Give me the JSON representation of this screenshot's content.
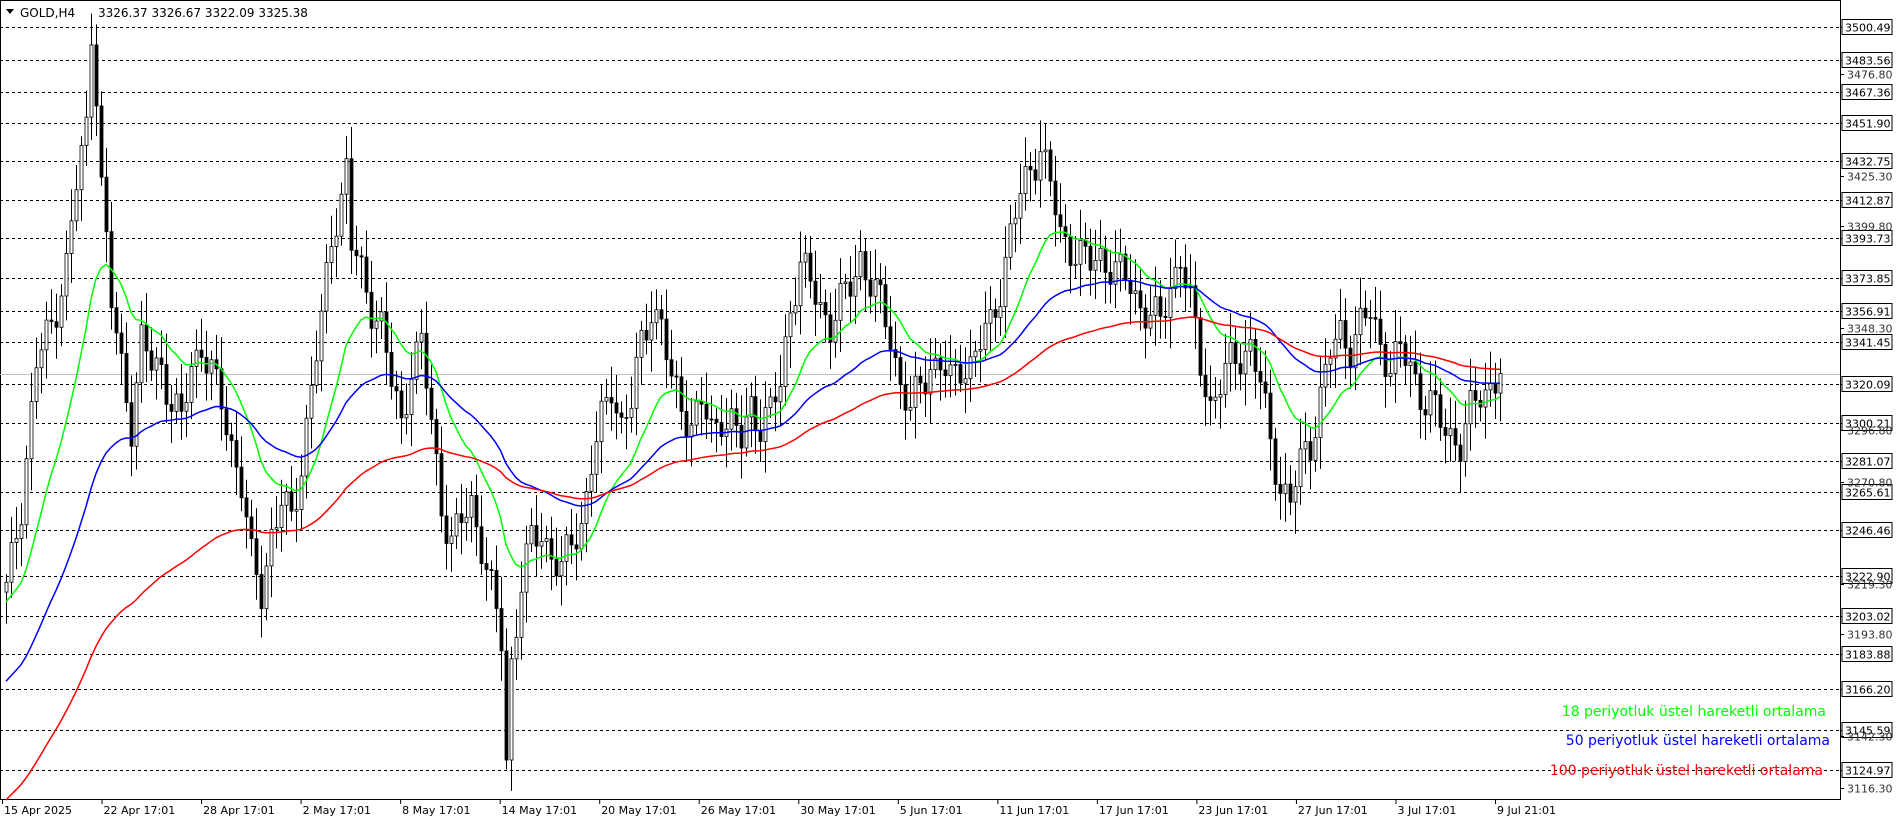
{
  "header": {
    "arrow_icon": "triangle-down-icon",
    "symbol": "GOLD,H4",
    "ohlc": "3326.37 3326.67 3322.09 3325.38"
  },
  "colors": {
    "background": "#ffffff",
    "grid": "#000000",
    "candle": "#000000",
    "ema18": "#00ff00",
    "ema50": "#0000ff",
    "ema100": "#ff0000",
    "bid_line": "#c0c0c0"
  },
  "legend": [
    {
      "text": "18 periyotluk üstel hareketli ortalama",
      "color": "#00ff00"
    },
    {
      "text": "50 periyotluk üstel hareketli ortalama",
      "color": "#0000ff"
    },
    {
      "text": "100 periyotluk üstel hareketli ortalama",
      "color": "#ff0000"
    }
  ],
  "chart_data": {
    "type": "line",
    "title": "GOLD,H4",
    "ylim": [
      3110,
      3514
    ],
    "grid": "horizontal dashed lines at boxed price levels",
    "price_levels": [
      3500.49,
      3483.56,
      3467.36,
      3451.9,
      3432.75,
      3412.87,
      3393.73,
      3373.85,
      3356.91,
      3341.45,
      3320.09,
      3300.21,
      3281.07,
      3265.61,
      3246.46,
      3222.9,
      3203.02,
      3183.88,
      3166.2,
      3145.59,
      3124.97
    ],
    "plain_tick_labels": [
      3476.8,
      3425.3,
      3399.8,
      3348.3,
      3296.8,
      3270.8,
      3219.3,
      3193.8,
      3142.3,
      3116.3
    ],
    "current_price": 3325.38,
    "x_labels": [
      "15 Apr 2025",
      "22 Apr 17:01",
      "28 Apr 17:01",
      "2 May 17:01",
      "8 May 17:01",
      "14 May 17:01",
      "20 May 17:01",
      "26 May 17:01",
      "30 May 17:01",
      "5 Jun 17:01",
      "11 Jun 17:01",
      "17 Jun 17:01",
      "23 Jun 17:01",
      "27 Jun 17:01",
      "3 Jul 17:01",
      "9 Jul 21:01"
    ],
    "close_profile": [
      [
        0,
        3215
      ],
      [
        3,
        3260
      ],
      [
        6,
        3330
      ],
      [
        9,
        3350
      ],
      [
        12,
        3380
      ],
      [
        14,
        3420
      ],
      [
        16,
        3450
      ],
      [
        17,
        3500
      ],
      [
        18,
        3470
      ],
      [
        19,
        3420
      ],
      [
        21,
        3360
      ],
      [
        23,
        3330
      ],
      [
        25,
        3300
      ],
      [
        27,
        3340
      ],
      [
        29,
        3330
      ],
      [
        31,
        3330
      ],
      [
        33,
        3310
      ],
      [
        35,
        3300
      ],
      [
        37,
        3330
      ],
      [
        39,
        3340
      ],
      [
        41,
        3325
      ],
      [
        43,
        3310
      ],
      [
        45,
        3290
      ],
      [
        47,
        3270
      ],
      [
        49,
        3230
      ],
      [
        51,
        3215
      ],
      [
        53,
        3245
      ],
      [
        55,
        3260
      ],
      [
        57,
        3250
      ],
      [
        59,
        3280
      ],
      [
        61,
        3320
      ],
      [
        63,
        3350
      ],
      [
        65,
        3395
      ],
      [
        67,
        3415
      ],
      [
        68,
        3430
      ],
      [
        69,
        3390
      ],
      [
        71,
        3375
      ],
      [
        73,
        3360
      ],
      [
        75,
        3350
      ],
      [
        77,
        3320
      ],
      [
        79,
        3300
      ],
      [
        81,
        3330
      ],
      [
        83,
        3340
      ],
      [
        85,
        3300
      ],
      [
        87,
        3260
      ],
      [
        89,
        3240
      ],
      [
        91,
        3250
      ],
      [
        93,
        3260
      ],
      [
        95,
        3240
      ],
      [
        97,
        3215
      ],
      [
        99,
        3190
      ],
      [
        100,
        3130
      ],
      [
        101,
        3180
      ],
      [
        103,
        3220
      ],
      [
        105,
        3240
      ],
      [
        107,
        3245
      ],
      [
        109,
        3235
      ],
      [
        111,
        3225
      ],
      [
        113,
        3240
      ],
      [
        115,
        3250
      ],
      [
        117,
        3280
      ],
      [
        119,
        3300
      ],
      [
        121,
        3320
      ],
      [
        123,
        3300
      ],
      [
        125,
        3310
      ],
      [
        127,
        3340
      ],
      [
        129,
        3360
      ],
      [
        131,
        3350
      ],
      [
        133,
        3320
      ],
      [
        135,
        3310
      ],
      [
        137,
        3300
      ],
      [
        139,
        3310
      ],
      [
        141,
        3295
      ],
      [
        143,
        3305
      ],
      [
        145,
        3300
      ],
      [
        147,
        3290
      ],
      [
        149,
        3310
      ],
      [
        151,
        3300
      ],
      [
        153,
        3305
      ],
      [
        155,
        3320
      ],
      [
        157,
        3360
      ],
      [
        159,
        3380
      ],
      [
        161,
        3370
      ],
      [
        163,
        3360
      ],
      [
        165,
        3350
      ],
      [
        167,
        3360
      ],
      [
        169,
        3370
      ],
      [
        171,
        3385
      ],
      [
        173,
        3370
      ],
      [
        175,
        3360
      ],
      [
        177,
        3345
      ],
      [
        179,
        3320
      ],
      [
        181,
        3305
      ],
      [
        183,
        3320
      ],
      [
        185,
        3330
      ],
      [
        187,
        3330
      ],
      [
        189,
        3320
      ],
      [
        191,
        3330
      ],
      [
        193,
        3330
      ],
      [
        195,
        3340
      ],
      [
        197,
        3350
      ],
      [
        199,
        3370
      ],
      [
        201,
        3395
      ],
      [
        203,
        3415
      ],
      [
        205,
        3430
      ],
      [
        207,
        3440
      ],
      [
        209,
        3420
      ],
      [
        211,
        3395
      ],
      [
        213,
        3390
      ],
      [
        215,
        3385
      ],
      [
        217,
        3380
      ],
      [
        219,
        3385
      ],
      [
        221,
        3380
      ],
      [
        223,
        3375
      ],
      [
        225,
        3370
      ],
      [
        227,
        3360
      ],
      [
        229,
        3355
      ],
      [
        231,
        3350
      ],
      [
        233,
        3370
      ],
      [
        235,
        3385
      ],
      [
        237,
        3360
      ],
      [
        239,
        3330
      ],
      [
        241,
        3310
      ],
      [
        243,
        3320
      ],
      [
        245,
        3330
      ],
      [
        247,
        3335
      ],
      [
        249,
        3340
      ],
      [
        251,
        3320
      ],
      [
        253,
        3290
      ],
      [
        255,
        3270
      ],
      [
        257,
        3260
      ],
      [
        259,
        3280
      ],
      [
        261,
        3290
      ],
      [
        263,
        3315
      ],
      [
        265,
        3335
      ],
      [
        267,
        3345
      ],
      [
        269,
        3340
      ],
      [
        271,
        3350
      ],
      [
        273,
        3355
      ],
      [
        275,
        3340
      ],
      [
        277,
        3330
      ],
      [
        279,
        3335
      ],
      [
        281,
        3330
      ],
      [
        283,
        3315
      ],
      [
        285,
        3310
      ],
      [
        287,
        3300
      ],
      [
        289,
        3295
      ],
      [
        291,
        3290
      ],
      [
        293,
        3305
      ],
      [
        295,
        3315
      ],
      [
        297,
        3320
      ],
      [
        299,
        3325
      ]
    ],
    "series": [
      {
        "name": "18 periyotluk üstel hareketli ortalama",
        "period": 18
      },
      {
        "name": "50 periyotluk üstel hareketli ortalama",
        "period": 50
      },
      {
        "name": "100 periyotluk üstel hareketli ortalama",
        "period": 100
      }
    ]
  }
}
